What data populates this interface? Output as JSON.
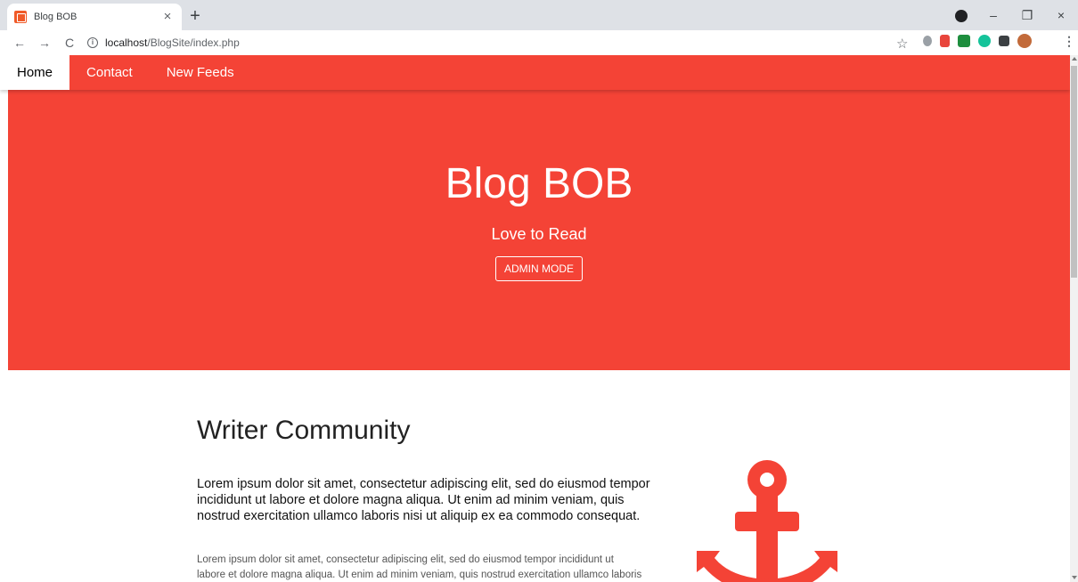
{
  "browser": {
    "tab_title": "Blog BOB",
    "tab_close": "×",
    "new_tab": "+",
    "url_host": "localhost",
    "url_path": "/BlogSite/index.php",
    "nav_back": "←",
    "nav_forward": "→",
    "nav_reload": "C",
    "star": "☆",
    "menu": "⋮",
    "minimize": "–",
    "restore": "❐",
    "close": "×"
  },
  "nav": {
    "items": [
      {
        "label": "Home"
      },
      {
        "label": "Contact"
      },
      {
        "label": "New Feeds"
      }
    ]
  },
  "hero": {
    "title": "Blog BOB",
    "subtitle": "Love to Read",
    "button": "ADMIN MODE"
  },
  "section": {
    "title": "Writer Community",
    "lead": "Lorem ipsum dolor sit amet, consectetur adipiscing elit, sed do eiusmod tempor incididunt ut labore et dolore magna aliqua. Ut enim ad minim veniam, quis nostrud exercitation ullamco laboris nisi ut aliquip ex ea commodo consequat.",
    "body": "Lorem ipsum dolor sit amet, consectetur adipiscing elit, sed do eiusmod tempor incididunt ut labore et dolore magna aliqua. Ut enim ad minim veniam, quis nostrud exercitation ullamco laboris nisi ut"
  },
  "colors": {
    "accent": "#f44336",
    "chrome": "#dee1e6"
  },
  "icons": {
    "anchor": "anchor-icon"
  }
}
